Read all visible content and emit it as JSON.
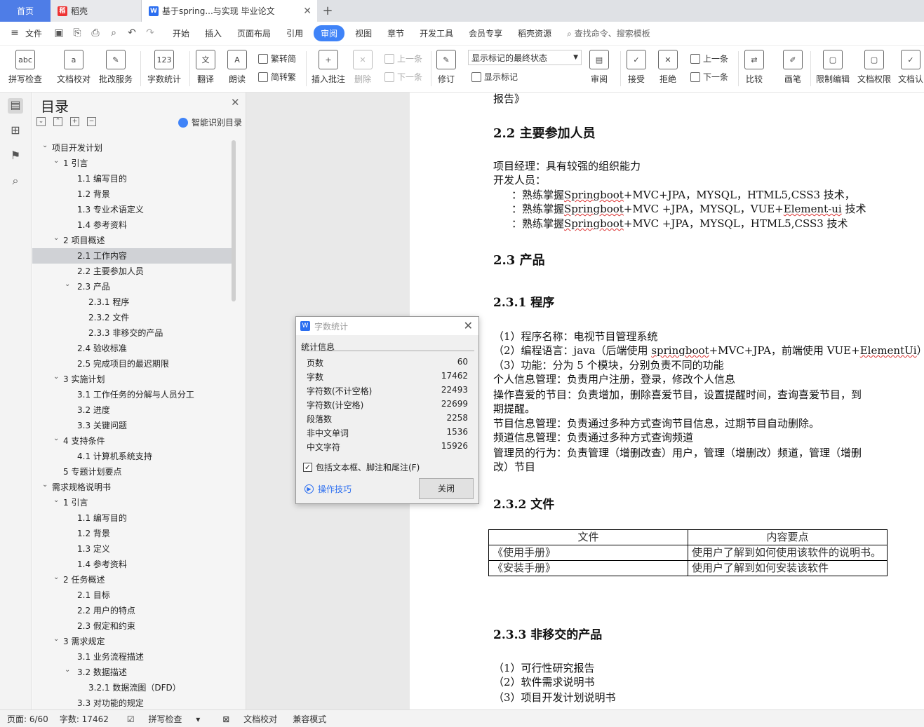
{
  "tabs": {
    "home": "首页",
    "daoke": "稻壳",
    "doc": "基于spring...与实现 毕业论文"
  },
  "menu": {
    "file": "文件",
    "items": [
      "开始",
      "插入",
      "页面布局",
      "引用",
      "审阅",
      "视图",
      "章节",
      "开发工具",
      "会员专享",
      "稻壳资源"
    ],
    "search": "查找命令、搜索模板"
  },
  "ribbon": {
    "spell": "拼写检查",
    "proof": "文档校对",
    "batch": "批改服务",
    "wordcount": "字数统计",
    "translate": "翻译",
    "read": "朗读",
    "t2s": "繁转简",
    "s2t": "简转繁",
    "insert_comment": "插入批注",
    "delete": "删除",
    "prev_comment": "上一条",
    "next_comment": "下一条",
    "revise": "修订",
    "show_state": "显示标记的最终状态",
    "show_marks": "显示标记",
    "review": "审阅",
    "accept": "接受",
    "reject": "拒绝",
    "prev": "上一条",
    "next": "下一条",
    "compare": "比较",
    "pen": "画笔",
    "limit_edit": "限制编辑",
    "doc_rights": "文档权限",
    "doc_auth": "文档认"
  },
  "toc": {
    "title": "目录",
    "smart": "智能识别目录",
    "items": [
      "项目开发计划",
      "1 引言",
      "1.1 编写目的",
      "1.2 背景",
      "1.3 专业术语定义",
      "1.4 参考资料",
      "2 项目概述",
      "2.1 工作内容",
      "2.2 主要参加人员",
      "2.3 产品",
      "2.3.1 程序",
      "2.3.2 文件",
      "2.3.3 非移交的产品",
      "2.4 验收标准",
      "2.5 完成项目的最迟期限",
      "3 实施计划",
      "3.1 工作任务的分解与人员分工",
      "3.2 进度",
      "3.3 关键问题",
      "4 支持条件",
      "4.1 计算机系统支持",
      "5 专题计划要点",
      "需求规格说明书",
      "1 引言",
      "1.1 编写目的",
      "1.2 背景",
      "1.3 定义",
      "1.4 参考资料",
      "2 任务概述",
      "2.1 目标",
      "2.2 用户的特点",
      "2.3 假定和约束",
      "3 需求规定",
      "3.1 业务流程描述",
      "3.2 数据描述",
      "3.2.1 数据流图（DFD）",
      "3.3 对功能的规定"
    ]
  },
  "doc": {
    "l0": "报告》",
    "h22": "2.2 主要参加人员",
    "pm": "项目经理：具有较强的组织能力",
    "dev": "开发人员：",
    "d1a": "：熟练掌握",
    "d1b": "Springboot",
    "d1c": "+MVC+JPA，MYSQL，HTML5,CSS3 技术，",
    "d2a": "：熟练掌握",
    "d2b": "Springboot",
    "d2c": "+MVC +JPA，MYSQL，VUE+",
    "d2d": "Element-ui",
    "d2e": " 技术",
    "d3a": "：熟练掌握",
    "d3b": "Springboot",
    "d3c": "+MVC +JPA，MYSQL，HTML5,CSS3 技术",
    "h23": "2.3 产品",
    "h231": "2.3.1  程序",
    "p1": "（1）程序名称：电视节目管理系统",
    "p2a": "（2）编程语言：java（后端使用 ",
    "p2b": "springboot",
    "p2c": "+MVC+JPA，前端使用 VUE+",
    "p2d": "ElementUi",
    "p2e": "）",
    "p3": "（3）功能：分为 5 个模块，分别负责不同的功能",
    "p4": "个人信息管理：负责用户注册，登录，修改个人信息",
    "p5": "操作喜爱的节目：负责增加，删除喜爱节目，设置提醒时间，查询喜爱节目，到",
    "p6": "期提醒。",
    "p7": "节目信息管理：负责通过多种方式查询节目信息，过期节目自动删除。",
    "p8": "频道信息管理：负责通过多种方式查询频道",
    "p9": "管理员的行为：负责管理（增删改查）用户，管理（增删改）频道，管理（增删",
    "p10": "改）节目",
    "h232": "2.3.2  文件",
    "table": {
      "h1": "文件",
      "h2": "内容要点",
      "r1c1": "《使用手册》",
      "r1c2": "使用户了解到如何使用该软件的说明书。",
      "r2c1": "《安装手册》",
      "r2c2": "使用户了解到如何安装该软件"
    },
    "h233": "2.3.3  非移交的产品",
    "q1": "（1）可行性研究报告",
    "q2": "（2）软件需求说明书",
    "q3": "（3）项目开发计划说明书"
  },
  "dialog": {
    "title": "字数统计",
    "group": "统计信息",
    "rows": [
      {
        "k": "页数",
        "v": "60"
      },
      {
        "k": "字数",
        "v": "17462"
      },
      {
        "k": "字符数(不计空格)",
        "v": "22493"
      },
      {
        "k": "字符数(计空格)",
        "v": "22699"
      },
      {
        "k": "段落数",
        "v": "2258"
      },
      {
        "k": "非中文单词",
        "v": "1536"
      },
      {
        "k": "中文字符",
        "v": "15926"
      }
    ],
    "include": "包括文本框、脚注和尾注(F)",
    "tips": "操作技巧",
    "close": "关闭"
  },
  "status": {
    "page": "页面: 6/60",
    "words": "字数: 17462",
    "spell": "拼写检查",
    "proof": "文档校对",
    "compat": "兼容模式"
  }
}
